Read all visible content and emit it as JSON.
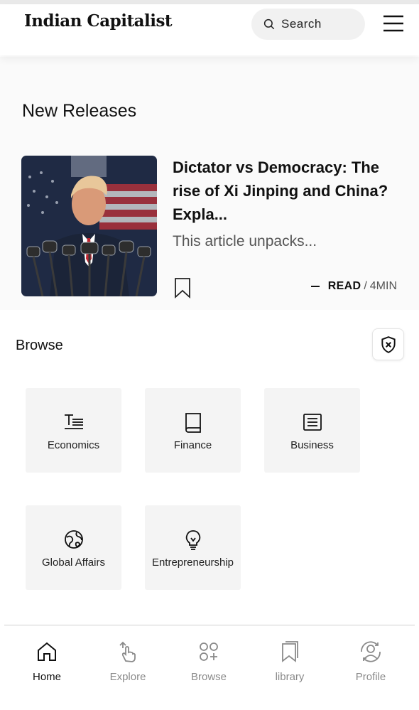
{
  "header": {
    "brand": "Indian Capitalist",
    "search_label": "Search"
  },
  "new_releases": {
    "title": "New Releases",
    "article": {
      "title": "Dictator vs Democracy: The rise of Xi Jinping and China? Expla...",
      "description": "This article unpacks...",
      "read_label": "READ",
      "separator": "/",
      "read_time": "4MIN"
    }
  },
  "browse": {
    "title": "Browse",
    "categories": [
      {
        "label": "Economics",
        "icon": "text-lines-icon"
      },
      {
        "label": "Finance",
        "icon": "book-icon"
      },
      {
        "label": "Business",
        "icon": "document-icon"
      },
      {
        "label": "Global Affairs",
        "icon": "globe-icon"
      },
      {
        "label": "Entrepreneurship",
        "icon": "lightbulb-icon"
      }
    ]
  },
  "nav": {
    "items": [
      {
        "label": "Home",
        "icon": "home-icon",
        "active": true
      },
      {
        "label": "Explore",
        "icon": "explore-icon",
        "active": false
      },
      {
        "label": "Browse",
        "icon": "browse-icon",
        "active": false
      },
      {
        "label": "library",
        "icon": "library-icon",
        "active": false
      },
      {
        "label": "Profile",
        "icon": "profile-icon",
        "active": false
      }
    ]
  },
  "colors": {
    "text": "#111111",
    "muted": "#8a8a8a",
    "tile_bg": "#f4f4f4",
    "search_bg": "#f1f1f1"
  }
}
